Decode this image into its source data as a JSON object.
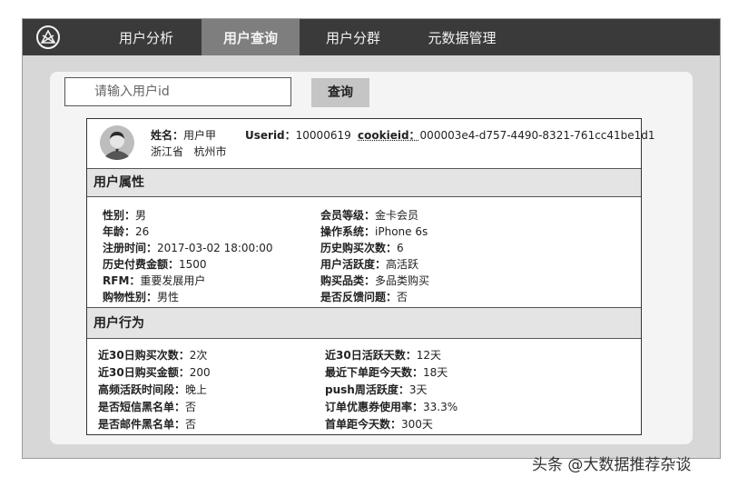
{
  "nav": {
    "tabs": [
      {
        "label": "用户分析"
      },
      {
        "label": "用户查询",
        "active": true
      },
      {
        "label": "用户分群"
      },
      {
        "label": "元数据管理"
      }
    ]
  },
  "search": {
    "placeholder": "请输入用户id",
    "button_label": "查询"
  },
  "profile": {
    "name_label": "姓名：",
    "name_value": "用户甲",
    "userid_label": "Userid：",
    "userid_value": "10000619",
    "cookieid_label": "cookieid：",
    "cookieid_value": "000003e4-d757-4490-8321-761cc41be1d1",
    "province": "浙江省",
    "city": "杭州市"
  },
  "attributes": {
    "title": "用户属性",
    "left": [
      {
        "k": "性别：",
        "v": "男"
      },
      {
        "k": "年龄：",
        "v": "26"
      },
      {
        "k": "注册时间：",
        "v": "2017-03-02 18:00:00"
      },
      {
        "k": "历史付费金额：",
        "v": "1500"
      },
      {
        "k": "RFM：",
        "v": "重要发展用户"
      },
      {
        "k": "购物性别：",
        "v": "男性"
      }
    ],
    "right": [
      {
        "k": "会员等级：",
        "v": "金卡会员"
      },
      {
        "k": "操作系统：",
        "v": "iPhone 6s"
      },
      {
        "k": "历史购买次数：",
        "v": "6"
      },
      {
        "k": "用户活跃度：",
        "v": "高活跃"
      },
      {
        "k": "购买品类：",
        "v": "多品类购买"
      },
      {
        "k": "是否反馈问题：",
        "v": "否"
      }
    ]
  },
  "behavior": {
    "title": "用户行为",
    "left": [
      {
        "k": "近30日购买次数：",
        "v": "2次"
      },
      {
        "k": "近30日购买金额：",
        "v": "200"
      },
      {
        "k": "高频活跃时间段：",
        "v": "晚上"
      },
      {
        "k": "是否短信黑名单：",
        "v": "否"
      },
      {
        "k": "是否邮件黑名单：",
        "v": "否"
      }
    ],
    "right": [
      {
        "k": "近30日活跃天数：",
        "v": "12天"
      },
      {
        "k": "最近下单距今天数：",
        "v": "18天"
      },
      {
        "k": "push周活跃度：",
        "v": "3天"
      },
      {
        "k": "订单优惠券使用率：",
        "v": "33.3%"
      },
      {
        "k": "首单距今天数：",
        "v": "300天"
      }
    ]
  },
  "watermark": "头条 @大数据推荐杂谈",
  "colors": {
    "navbar": "#3a3a3a",
    "active_tab": "#7e7e7e",
    "frame": "#d7d7d7"
  }
}
